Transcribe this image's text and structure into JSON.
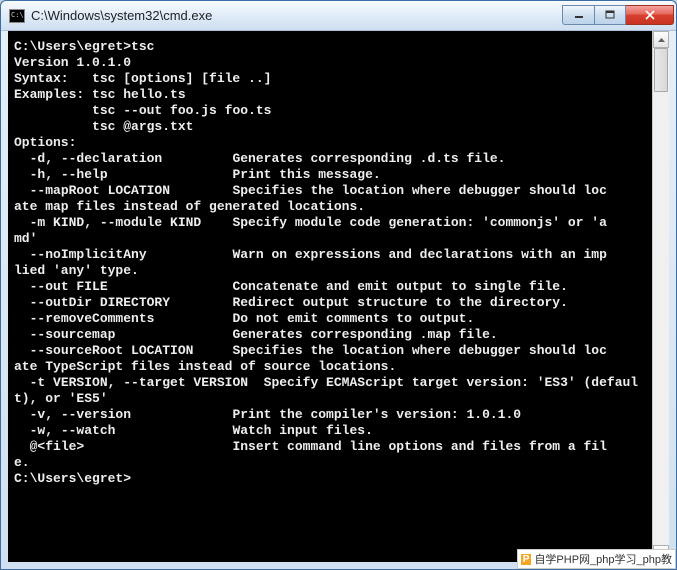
{
  "window": {
    "title": "C:\\Windows\\system32\\cmd.exe",
    "icon_text": "C:\\"
  },
  "terminal": {
    "lines": [
      "",
      "C:\\Users\\egret>tsc",
      "Version 1.0.1.0",
      "Syntax:   tsc [options] [file ..]",
      "",
      "Examples: tsc hello.ts",
      "          tsc --out foo.js foo.ts",
      "          tsc @args.txt",
      "",
      "Options:",
      "  -d, --declaration         Generates corresponding .d.ts file.",
      "  -h, --help                Print this message.",
      "  --mapRoot LOCATION        Specifies the location where debugger should loc",
      "ate map files instead of generated locations.",
      "  -m KIND, --module KIND    Specify module code generation: 'commonjs' or 'a",
      "md'",
      "  --noImplicitAny           Warn on expressions and declarations with an imp",
      "lied 'any' type.",
      "  --out FILE                Concatenate and emit output to single file.",
      "  --outDir DIRECTORY        Redirect output structure to the directory.",
      "  --removeComments          Do not emit comments to output.",
      "  --sourcemap               Generates corresponding .map file.",
      "  --sourceRoot LOCATION     Specifies the location where debugger should loc",
      "ate TypeScript files instead of source locations.",
      "  -t VERSION, --target VERSION  Specify ECMAScript target version: 'ES3' (defaul",
      "t), or 'ES5'",
      "  -v, --version             Print the compiler's version: 1.0.1.0",
      "  -w, --watch               Watch input files.",
      "  @<file>                   Insert command line options and files from a fil",
      "e.",
      "",
      "C:\\Users\\egret>"
    ]
  },
  "watermark": {
    "badge": "P",
    "text": "自学PHP网_php学习_php教"
  }
}
